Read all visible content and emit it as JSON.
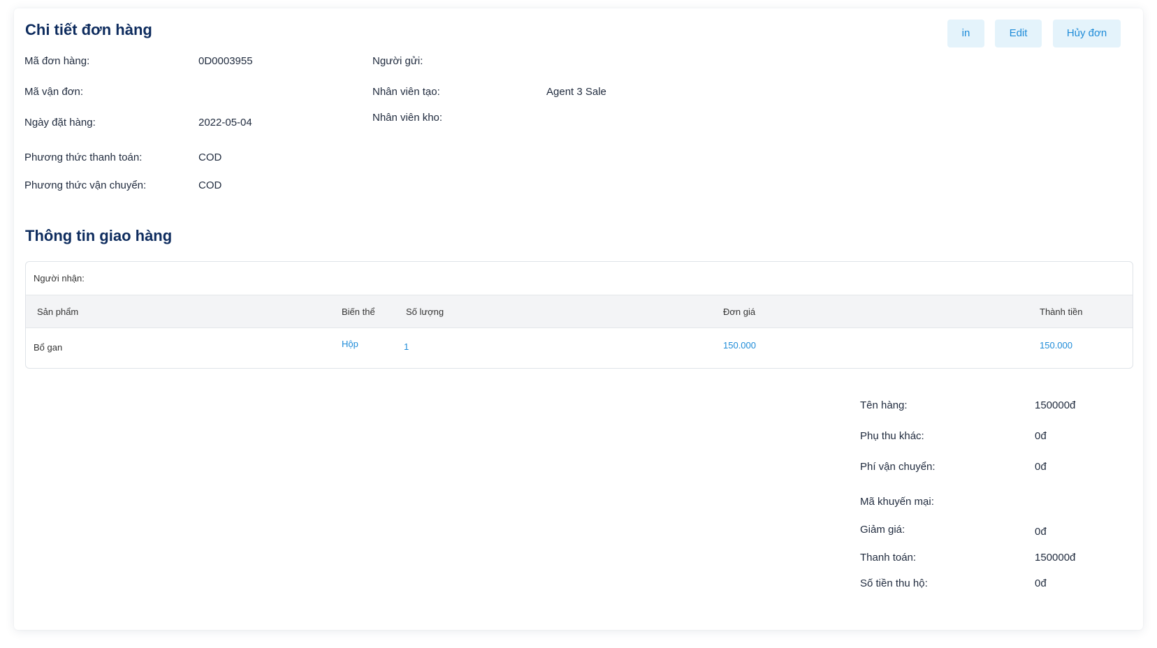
{
  "header": {
    "title": "Chi tiết đơn hàng",
    "buttons": {
      "print": "in",
      "edit": "Edit",
      "cancel": "Hủy đơn"
    }
  },
  "order_info": {
    "order_code_label": "Mã đơn hàng:",
    "order_code": "0D0003955",
    "waybill_label": "Mã vận đơn:",
    "waybill": "",
    "order_date_label": "Ngày đặt hàng:",
    "order_date": "2022-05-04",
    "payment_method_label": "Phương thức thanh toán:",
    "payment_method": "COD",
    "shipping_method_label": "Phương thức vận chuyển:",
    "shipping_method": "COD",
    "sender_label": "Người gửi:",
    "sender": "",
    "creator_label": "Nhân viên tạo:",
    "creator": "Agent 3 Sale",
    "warehouse_staff_label": "Nhân viên kho:",
    "warehouse_staff": ""
  },
  "delivery": {
    "title": "Thông tin giao hàng",
    "receiver_label": "Người nhận:",
    "columns": [
      "Sản phẩm",
      "Biến thể",
      "Số lượng",
      "Đơn giá",
      "Thành tiền"
    ],
    "rows": [
      {
        "product": "Bổ gan",
        "variant": "Hộp",
        "quantity": "1",
        "unit_price": "150.000",
        "total": "150.000"
      }
    ]
  },
  "summary": {
    "goods_label": "Tên hàng:",
    "goods": "150000đ",
    "surcharge_label": "Phụ thu khác:",
    "surcharge": "0đ",
    "shipping_fee_label": "Phí vận chuyển:",
    "shipping_fee": "0đ",
    "promo_label": "Mã khuyến mại:",
    "promo": "",
    "discount_label": "Giảm giá:",
    "discount": "0đ",
    "payment_label": "Thanh toán:",
    "payment": "150000đ",
    "cod_label": "Số tiền thu hộ:",
    "cod": "0đ"
  },
  "colors": {
    "title": "#0e2c5e",
    "accent": "#1d8bd8",
    "button_bg": "#e4f3fb"
  }
}
